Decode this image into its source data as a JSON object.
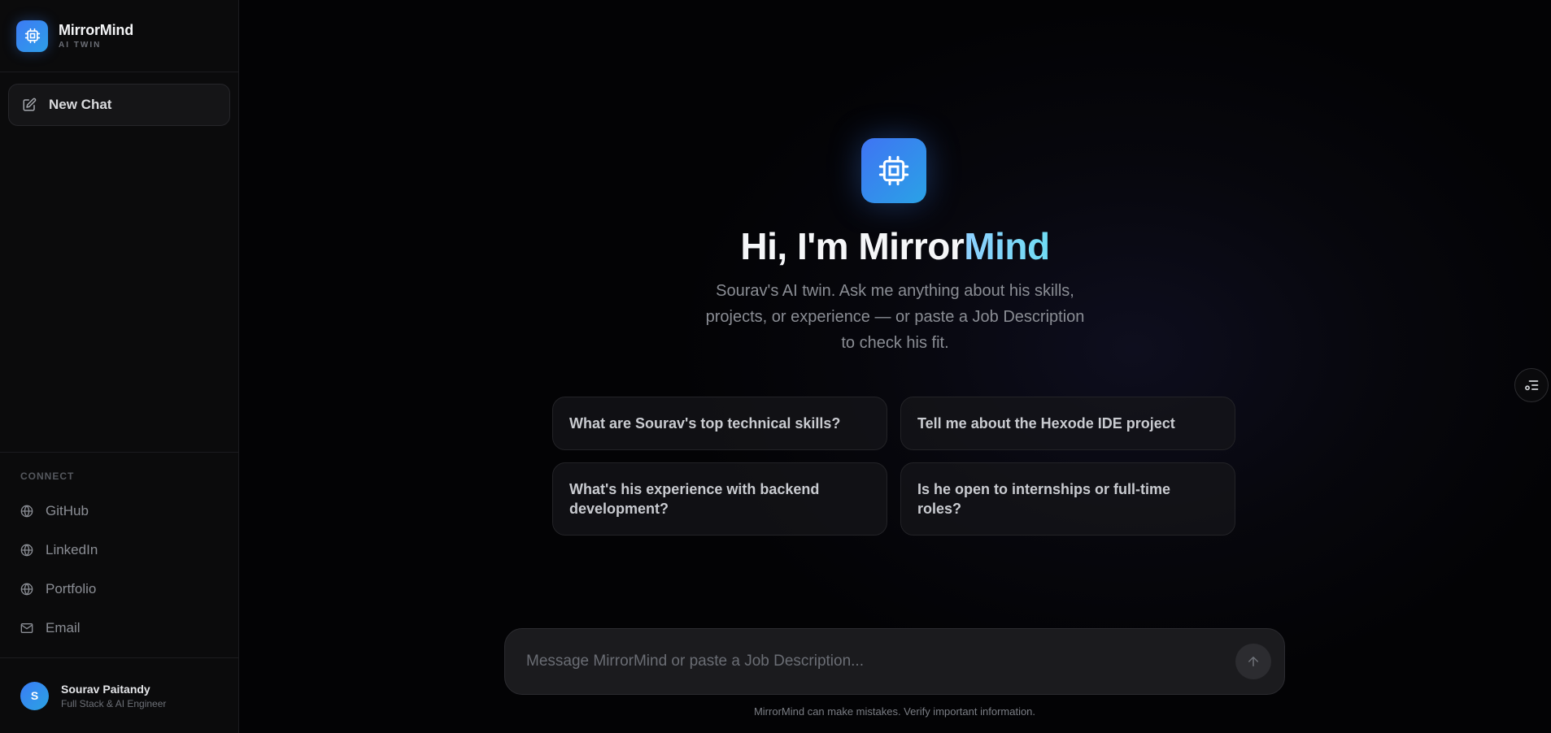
{
  "brand": {
    "name": "MirrorMind",
    "subtitle": "AI TWIN"
  },
  "sidebar": {
    "new_chat_label": "New Chat",
    "connect_title": "CONNECT",
    "links": [
      {
        "label": "GitHub",
        "icon": "globe-icon"
      },
      {
        "label": "LinkedIn",
        "icon": "globe-icon"
      },
      {
        "label": "Portfolio",
        "icon": "globe-icon"
      },
      {
        "label": "Email",
        "icon": "mail-icon"
      }
    ],
    "user": {
      "initial": "S",
      "name": "Sourav Paitandy",
      "role": "Full Stack & AI Engineer"
    }
  },
  "hero": {
    "title_prefix": "Hi, I'm Mirror",
    "title_accent": "Mind",
    "subtitle_lines": [
      "Sourav's AI twin. Ask me anything about his skills,",
      "projects, or experience — or paste a Job Description",
      "to check his fit."
    ]
  },
  "suggestions": [
    "What are Sourav's top technical skills?",
    "Tell me about the Hexode IDE project",
    "What's his experience with backend development?",
    "Is he open to internships or full-time roles?"
  ],
  "composer": {
    "placeholder": "Message MirrorMind or paste a Job Description...",
    "value": ""
  },
  "disclaimer": "MirrorMind can make mistakes. Verify important information.",
  "colors": {
    "accent": "#3b82f6",
    "accent_text": "#7dd3fc",
    "background": "#030305",
    "sidebar": "#0b0b0c"
  }
}
